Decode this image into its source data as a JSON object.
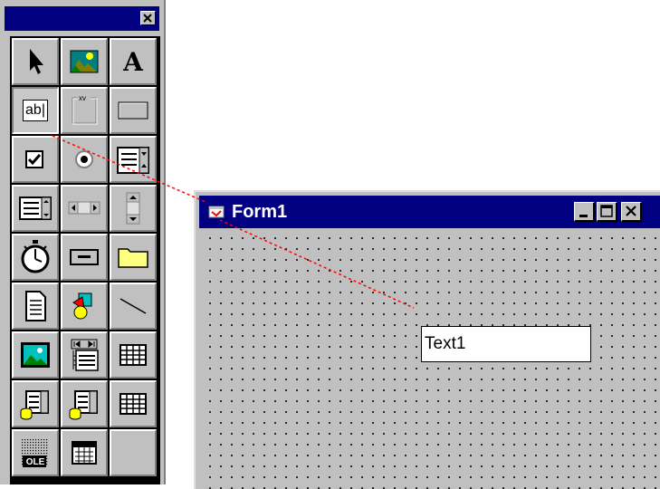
{
  "toolbox": {
    "close_glyph": "×",
    "tools": [
      {
        "name": "pointer-tool",
        "icon": "arrow-pointer-icon"
      },
      {
        "name": "picturebox-tool",
        "icon": "picture-icon"
      },
      {
        "name": "label-tool",
        "icon": "label-A-icon",
        "glyph": "A"
      },
      {
        "name": "textbox-tool",
        "icon": "textbox-icon",
        "glyph": "ab|"
      },
      {
        "name": "frame-tool",
        "icon": "frame-icon",
        "glyph": "xv"
      },
      {
        "name": "commandbutton-tool",
        "icon": "command-button-icon"
      },
      {
        "name": "checkbox-tool",
        "icon": "checkbox-icon"
      },
      {
        "name": "optionbutton-tool",
        "icon": "option-button-icon"
      },
      {
        "name": "combobox-tool",
        "icon": "combobox-icon"
      },
      {
        "name": "listbox-tool",
        "icon": "listbox-icon"
      },
      {
        "name": "hscrollbar-tool",
        "icon": "hscrollbar-icon"
      },
      {
        "name": "vscrollbar-tool",
        "icon": "vscrollbar-icon"
      },
      {
        "name": "timer-tool",
        "icon": "stopwatch-icon"
      },
      {
        "name": "drivelistbox-tool",
        "icon": "drive-icon"
      },
      {
        "name": "dirlistbox-tool",
        "icon": "folder-icon"
      },
      {
        "name": "filelistbox-tool",
        "icon": "file-icon"
      },
      {
        "name": "shape-tool",
        "icon": "shapes-icon"
      },
      {
        "name": "line-tool",
        "icon": "line-icon"
      },
      {
        "name": "image-tool",
        "icon": "image-icon"
      },
      {
        "name": "data-tool",
        "icon": "data-control-icon"
      },
      {
        "name": "grid-tool",
        "icon": "grid-icon"
      },
      {
        "name": "dbcombo-tool",
        "icon": "db-combo-icon"
      },
      {
        "name": "dblist-tool",
        "icon": "db-list-icon"
      },
      {
        "name": "dbgrid-tool",
        "icon": "db-grid-icon"
      },
      {
        "name": "ole-tool",
        "icon": "ole-icon",
        "glyph": "OLE"
      },
      {
        "name": "calendar-tool",
        "icon": "calendar-icon"
      },
      {
        "name": "empty-slot",
        "icon": ""
      }
    ]
  },
  "form": {
    "title": "Form1",
    "textbox_value": "Text1",
    "minimize_icon": "minimize-icon",
    "maximize_icon": "maximize-icon",
    "close_icon": "close-icon"
  },
  "colors": {
    "titlebar": "#000080",
    "face": "#c0c0c0",
    "connector": "#ff0000"
  }
}
